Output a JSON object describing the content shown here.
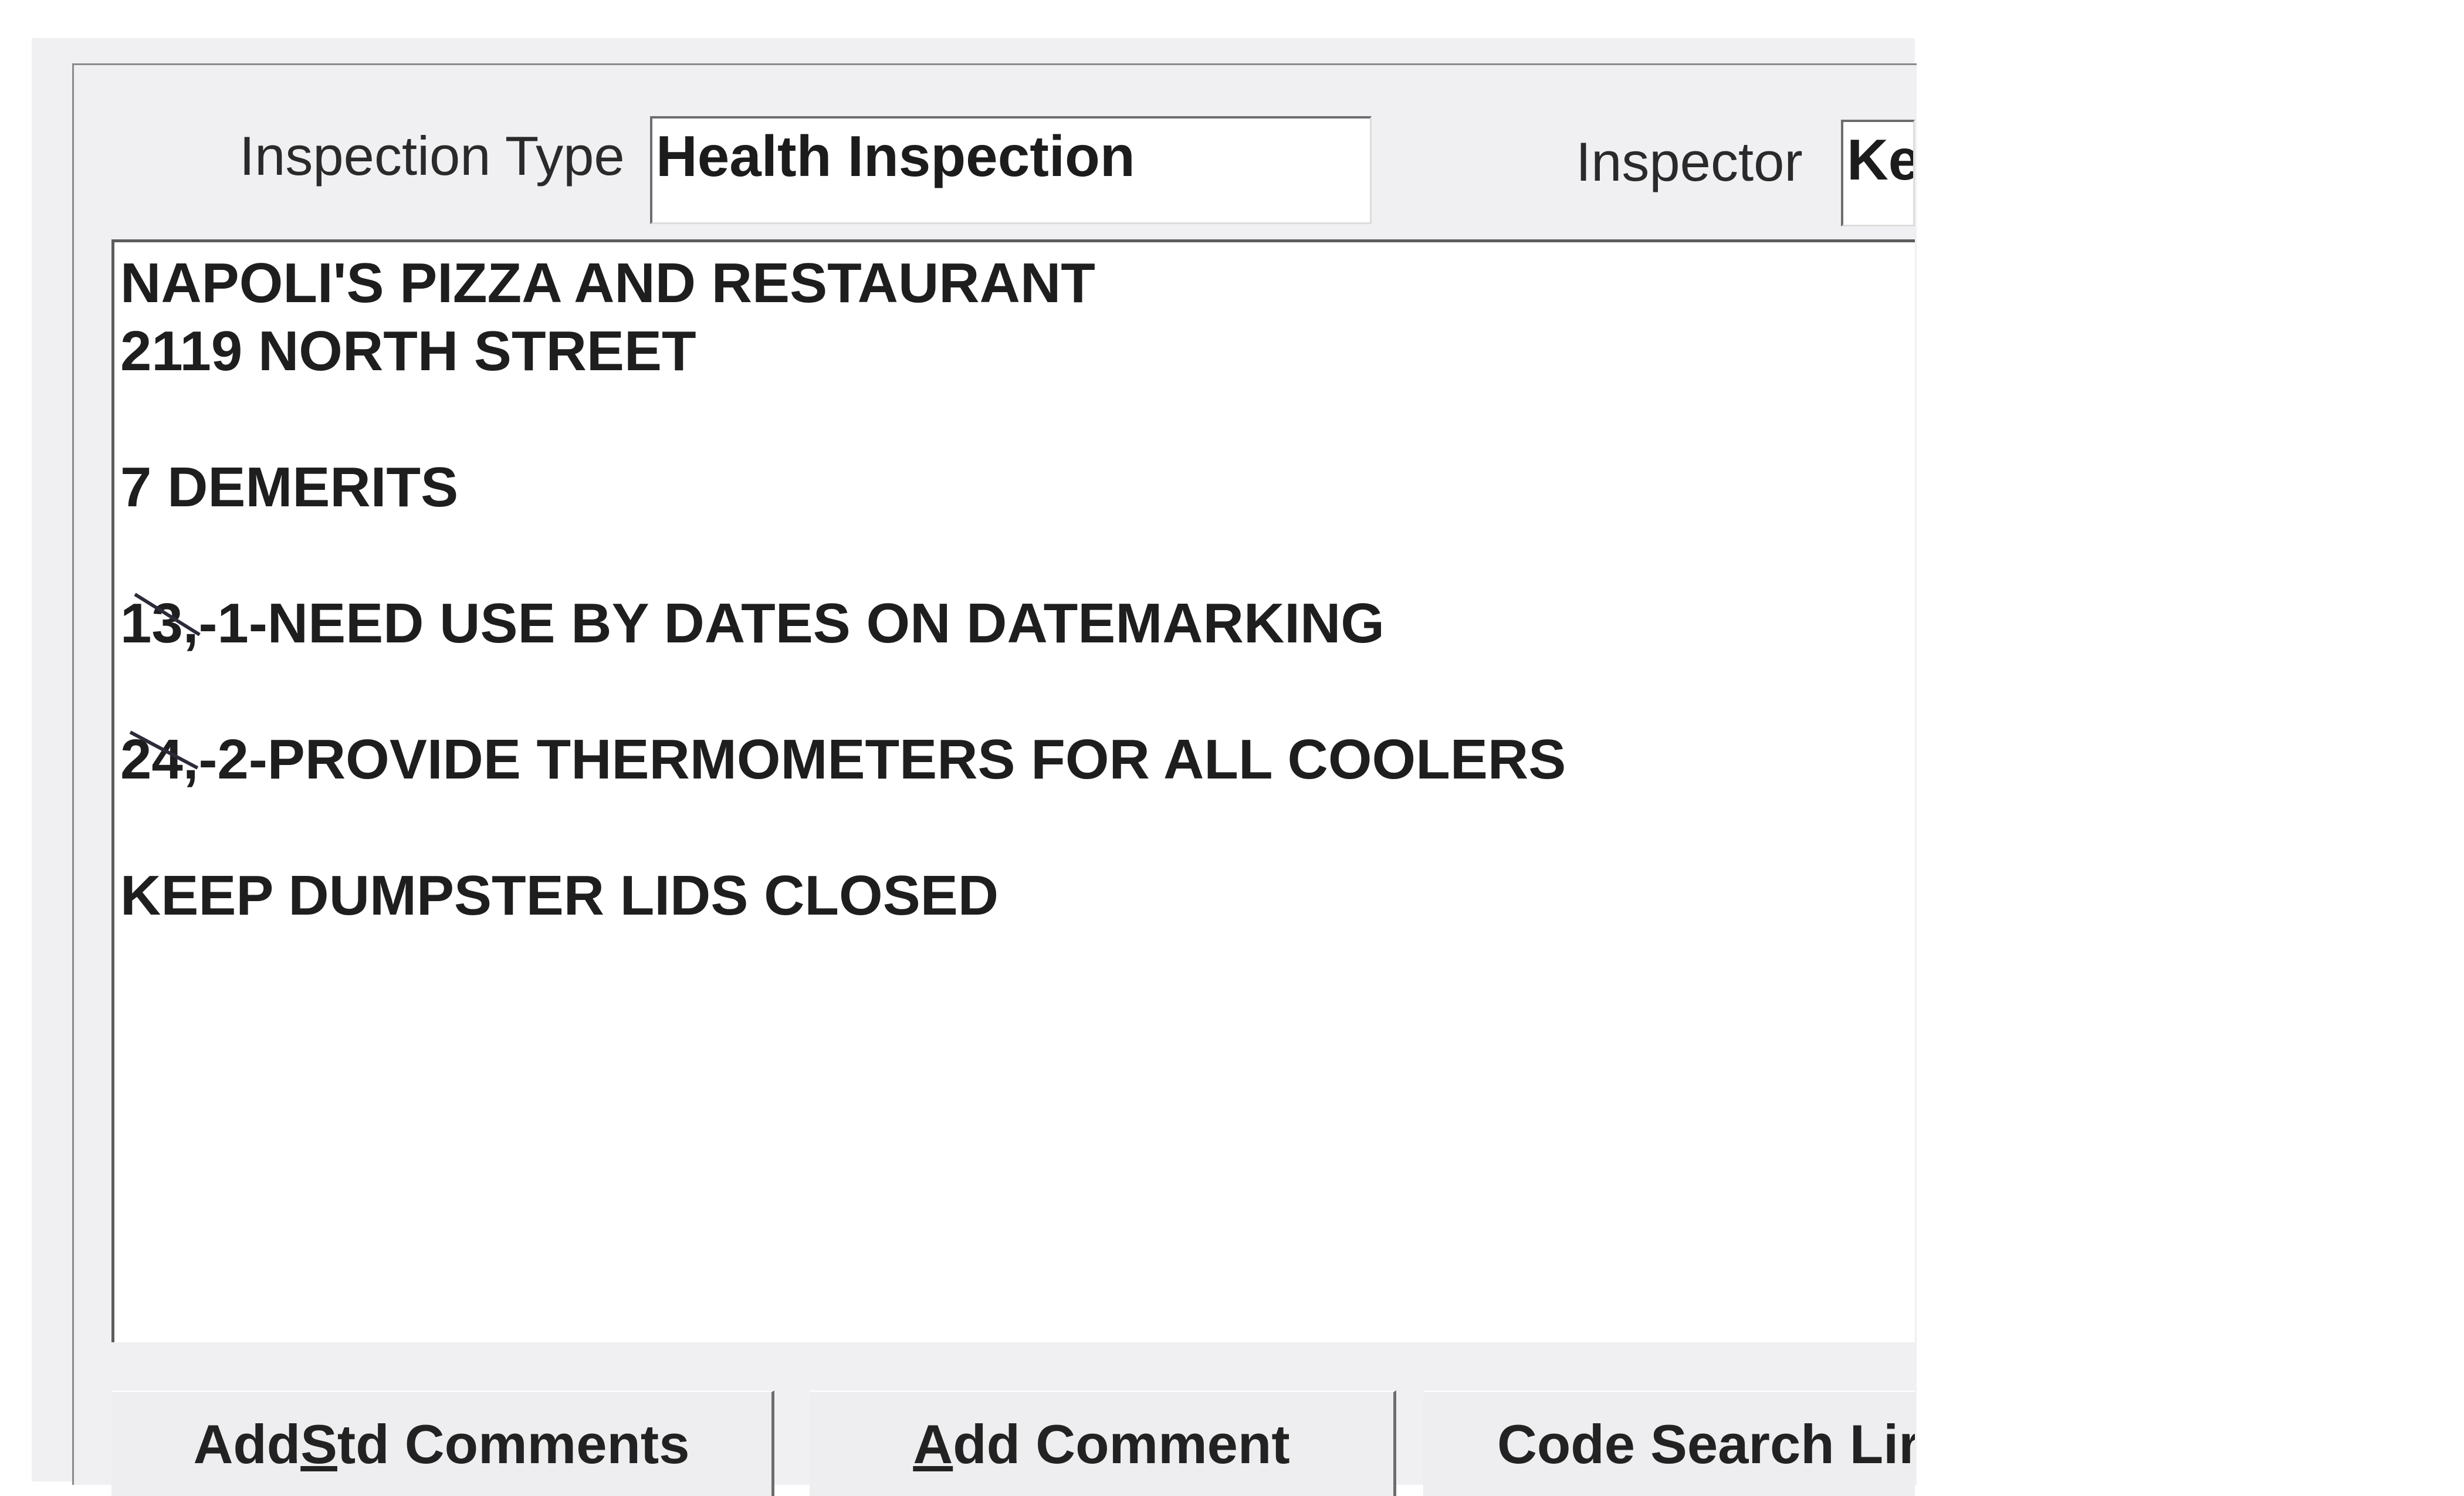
{
  "header": {
    "inspection_type_label": "Inspection Type",
    "inspection_type_value": "Health Inspection",
    "inspector_label": "Inspector",
    "inspector_value": "Ke"
  },
  "comments": {
    "lines": [
      "NAPOLI'S PIZZA AND RESTAURANT",
      "2119 NORTH STREET",
      "",
      "7 DEMERITS",
      "",
      "13,-1-NEED USE BY DATES ON DATEMARKING",
      "",
      "24,-2-PROVIDE THERMOMETERS FOR ALL COOLERS",
      "",
      "KEEP DUMPSTER LIDS CLOSED"
    ]
  },
  "buttons": {
    "add_std_comments": {
      "pre": "Add ",
      "mnemonic": "S",
      "post": "td Comments"
    },
    "add_comment": {
      "pre": "",
      "mnemonic": "A",
      "post": "dd Comment"
    },
    "code_search": {
      "label": "Code Search Lir"
    }
  },
  "colors": {
    "panel": "#f0f0f2",
    "field_bg": "#ffffff",
    "text": "#1c1c1c",
    "handwriting_mark": "#2b2b3a"
  }
}
